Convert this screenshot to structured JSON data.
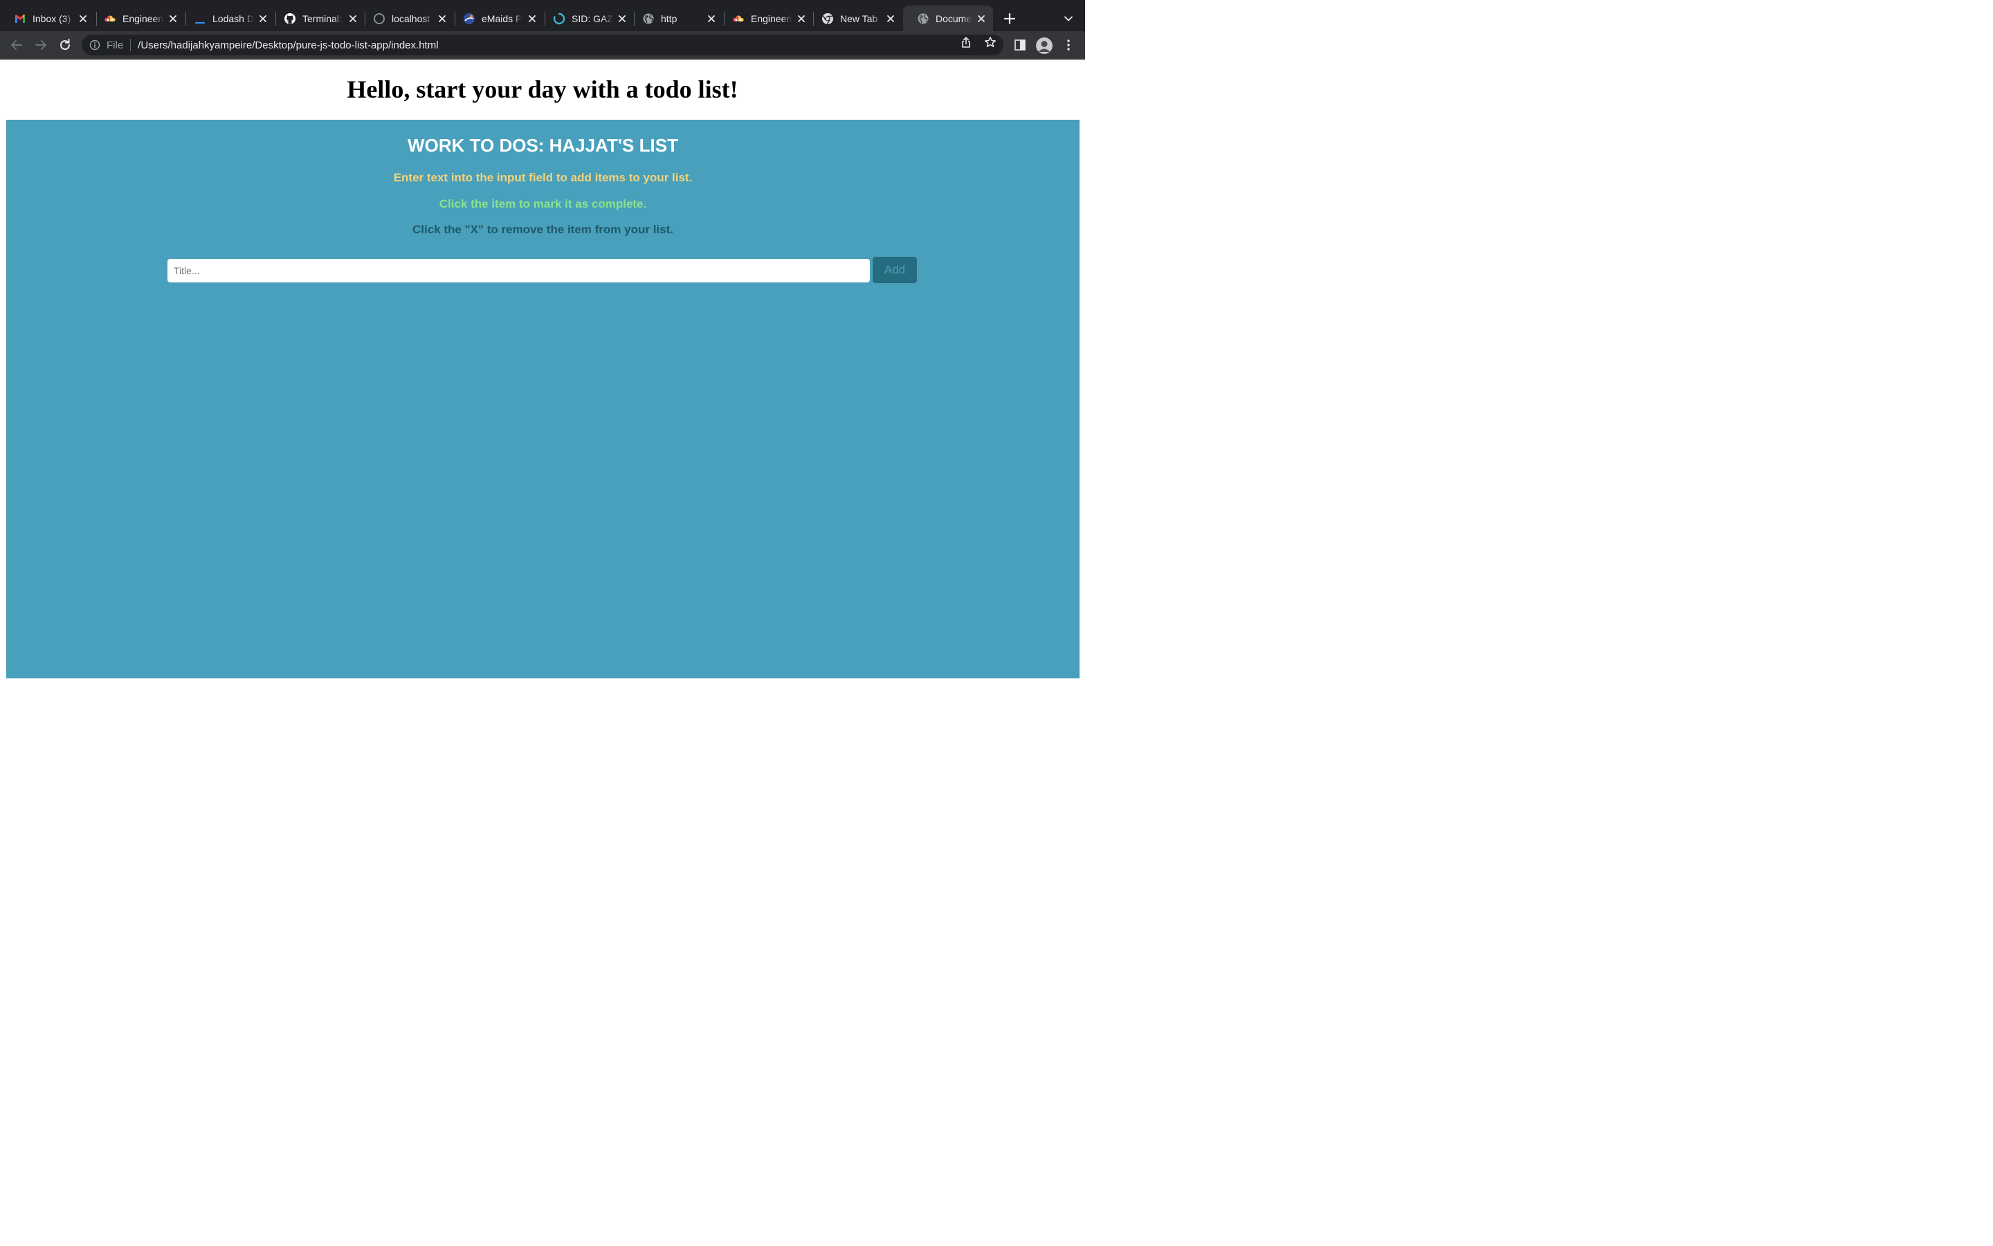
{
  "browser": {
    "tabs": [
      {
        "title": "Inbox (3)",
        "icon": "gmail-icon"
      },
      {
        "title": "Engineering",
        "icon": "cloud-icon"
      },
      {
        "title": "Lodash Docs",
        "icon": "lodash-icon"
      },
      {
        "title": "Terminal:",
        "icon": "github-icon"
      },
      {
        "title": "localhost",
        "icon": "loading-ring-icon"
      },
      {
        "title": "eMaids Fr",
        "icon": "emaids-icon"
      },
      {
        "title": "SID: GAZI",
        "icon": "spinner-icon"
      },
      {
        "title": "http",
        "icon": "globe-icon"
      },
      {
        "title": "Engineering",
        "icon": "cloud-icon"
      },
      {
        "title": "New Tab",
        "icon": "chrome-icon"
      },
      {
        "title": "Document",
        "icon": "globe-icon",
        "active": true
      }
    ],
    "address_bar": {
      "scheme_label": "File",
      "url": "/Users/hadijahkyampeire/Desktop/pure-js-todo-list-app/index.html"
    }
  },
  "page": {
    "heading": "Hello, start your day with a todo list!",
    "panel": {
      "title": "WORK TO DOS: HAJJAT'S LIST",
      "instruction_add": "Enter text into the input field to add items to your list.",
      "instruction_complete": "Click the item to mark it as complete.",
      "instruction_remove": "Click the \"X\" to remove the item from your list.",
      "input_placeholder": "Title...",
      "input_value": "",
      "add_button_label": "Add"
    }
  },
  "colors": {
    "panel_bg": "#48a0bc",
    "add_hint": "#f4d27a",
    "complete_hint": "#8be28b",
    "remove_hint": "#1f5a6a",
    "add_button_bg": "#256c80",
    "browser_frame": "#202124",
    "toolbar": "#35363a"
  }
}
